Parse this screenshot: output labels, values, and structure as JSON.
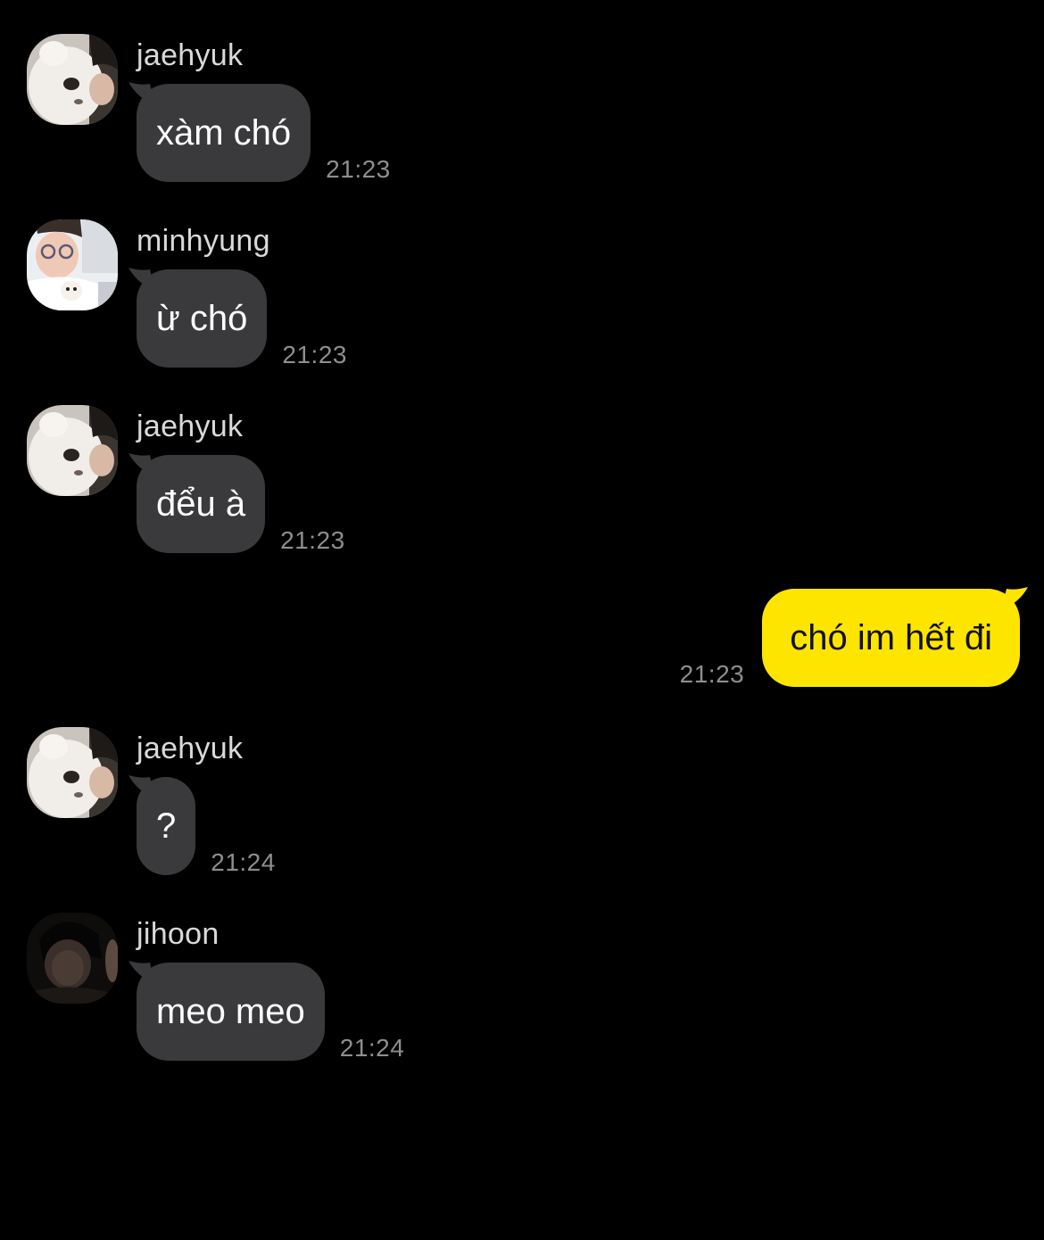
{
  "chat": {
    "messages": [
      {
        "sender": "jaehyuk",
        "text": "xàm chó",
        "time": "21:23",
        "avatar": "cat-photo-avatar"
      },
      {
        "sender": "minhyung",
        "text": "ừ chó",
        "time": "21:23",
        "avatar": "person-with-glasses-avatar"
      },
      {
        "sender": "jaehyuk",
        "text": "đểu à",
        "time": "21:23",
        "avatar": "cat-photo-avatar"
      },
      {
        "sender": "",
        "text": "chó im hết đi",
        "time": "21:23",
        "mine": true
      },
      {
        "sender": "jaehyuk",
        "text": "?",
        "time": "21:24",
        "avatar": "cat-photo-avatar"
      },
      {
        "sender": "jihoon",
        "text": "meo meo",
        "time": "21:24",
        "avatar": "dark-portrait-avatar"
      }
    ]
  },
  "colors": {
    "background": "#000000",
    "incoming_bubble": "#3a3a3c",
    "outgoing_bubble": "#fee500",
    "timestamp": "#8e8e8e",
    "sender_name": "#d9d9d9"
  }
}
